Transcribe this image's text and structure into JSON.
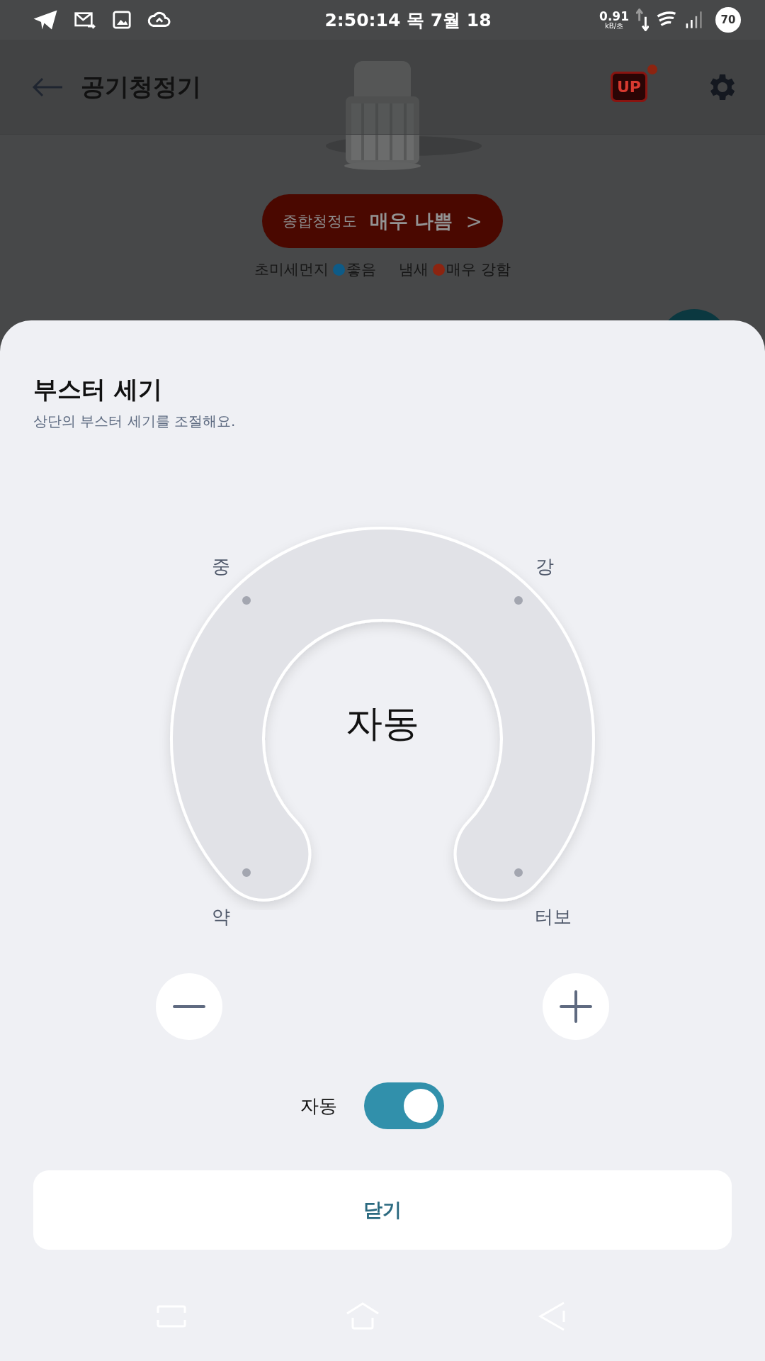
{
  "status_bar": {
    "time": "2:50:14 목 7월 18",
    "net_speed": "0.91",
    "net_unit": "kB/초",
    "battery": "70"
  },
  "header": {
    "title": "공기청정기",
    "up_badge": "UP",
    "has_notification": true
  },
  "air_quality": {
    "label": "종합청정도",
    "value": "매우 나쁨",
    "chevron": ">"
  },
  "legend": [
    {
      "label": "초미세먼지",
      "status": "좋음",
      "color": "#0e5b87"
    },
    {
      "label": "냄새",
      "status": "매우 강함",
      "color": "#8c2410"
    }
  ],
  "sheet": {
    "title": "부스터 세기",
    "subtitle": "상단의 부스터 세기를 조절해요.",
    "dial": {
      "center_text": "자동",
      "levels": [
        "중",
        "강",
        "약",
        "터보"
      ]
    },
    "auto": {
      "label": "자동",
      "on": true
    },
    "close_button": "닫기"
  }
}
